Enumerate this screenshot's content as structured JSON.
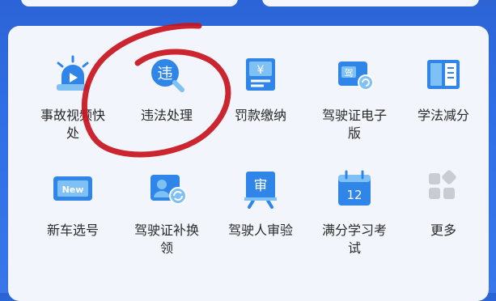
{
  "services": [
    {
      "label": "事故视频快处",
      "icon": "siren-icon"
    },
    {
      "label": "违法处理",
      "icon": "violation-search-icon",
      "icon_text": "违"
    },
    {
      "label": "罚款缴纳",
      "icon": "fine-payment-icon",
      "icon_text": "¥"
    },
    {
      "label": "驾驶证电子版",
      "icon": "e-license-icon",
      "icon_text": "驾"
    },
    {
      "label": "学法减分",
      "icon": "book-icon"
    },
    {
      "label": "新车选号",
      "icon": "new-plate-icon",
      "icon_text": "New"
    },
    {
      "label": "驾驶证补换领",
      "icon": "license-renew-icon"
    },
    {
      "label": "驾驶人审验",
      "icon": "review-icon",
      "icon_text": "审"
    },
    {
      "label": "满分学习考试",
      "icon": "calendar-exam-icon",
      "icon_text": "12"
    },
    {
      "label": "更多",
      "icon": "more-icon"
    }
  ],
  "colors": {
    "background": "#2f6ee6",
    "panel": "#f2f5fb",
    "icon_blue": "#2f86e8",
    "icon_light": "#7fc0f5",
    "ink_annotation": "#c8121d"
  }
}
